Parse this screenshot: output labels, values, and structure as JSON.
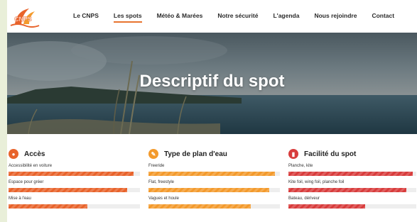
{
  "nav": {
    "logo_text": "CNPS",
    "items": [
      {
        "label": "Le CNPS",
        "active": false
      },
      {
        "label": "Les spots",
        "active": true
      },
      {
        "label": "Météo & Marées",
        "active": false
      },
      {
        "label": "Notre sécurité",
        "active": false
      },
      {
        "label": "L'agenda",
        "active": false
      },
      {
        "label": "Nous rejoindre",
        "active": false
      },
      {
        "label": "Contact",
        "active": false
      }
    ]
  },
  "hero": {
    "title": "Descriptif du spot"
  },
  "sections": [
    {
      "title": "Accès",
      "icon": "location-pin-icon",
      "color": "#e8632b",
      "bars": [
        {
          "label": "Accessibilité en voiture",
          "level": 0.95
        },
        {
          "label": "Espace pour gréer",
          "level": 0.9
        },
        {
          "label": "Mise à l'eau",
          "level": 0.6
        }
      ]
    },
    {
      "title": "Type de plan d'eau",
      "icon": "pencil-wave-icon",
      "color": "#f39a2c",
      "bars": [
        {
          "label": "Freeride",
          "level": 0.96
        },
        {
          "label": "Flat, freestyle",
          "level": 0.92
        },
        {
          "label": "Vagues et houle",
          "level": 0.78
        }
      ]
    },
    {
      "title": "Facilité du spot",
      "icon": "signal-bars-icon",
      "color": "#d83c3c",
      "bars": [
        {
          "label": "Planche, kite",
          "level": 0.97
        },
        {
          "label": "Kite foil, wing foil, planche foil",
          "level": 0.92
        },
        {
          "label": "Bateau, dériveur",
          "level": 0.6
        }
      ]
    }
  ]
}
